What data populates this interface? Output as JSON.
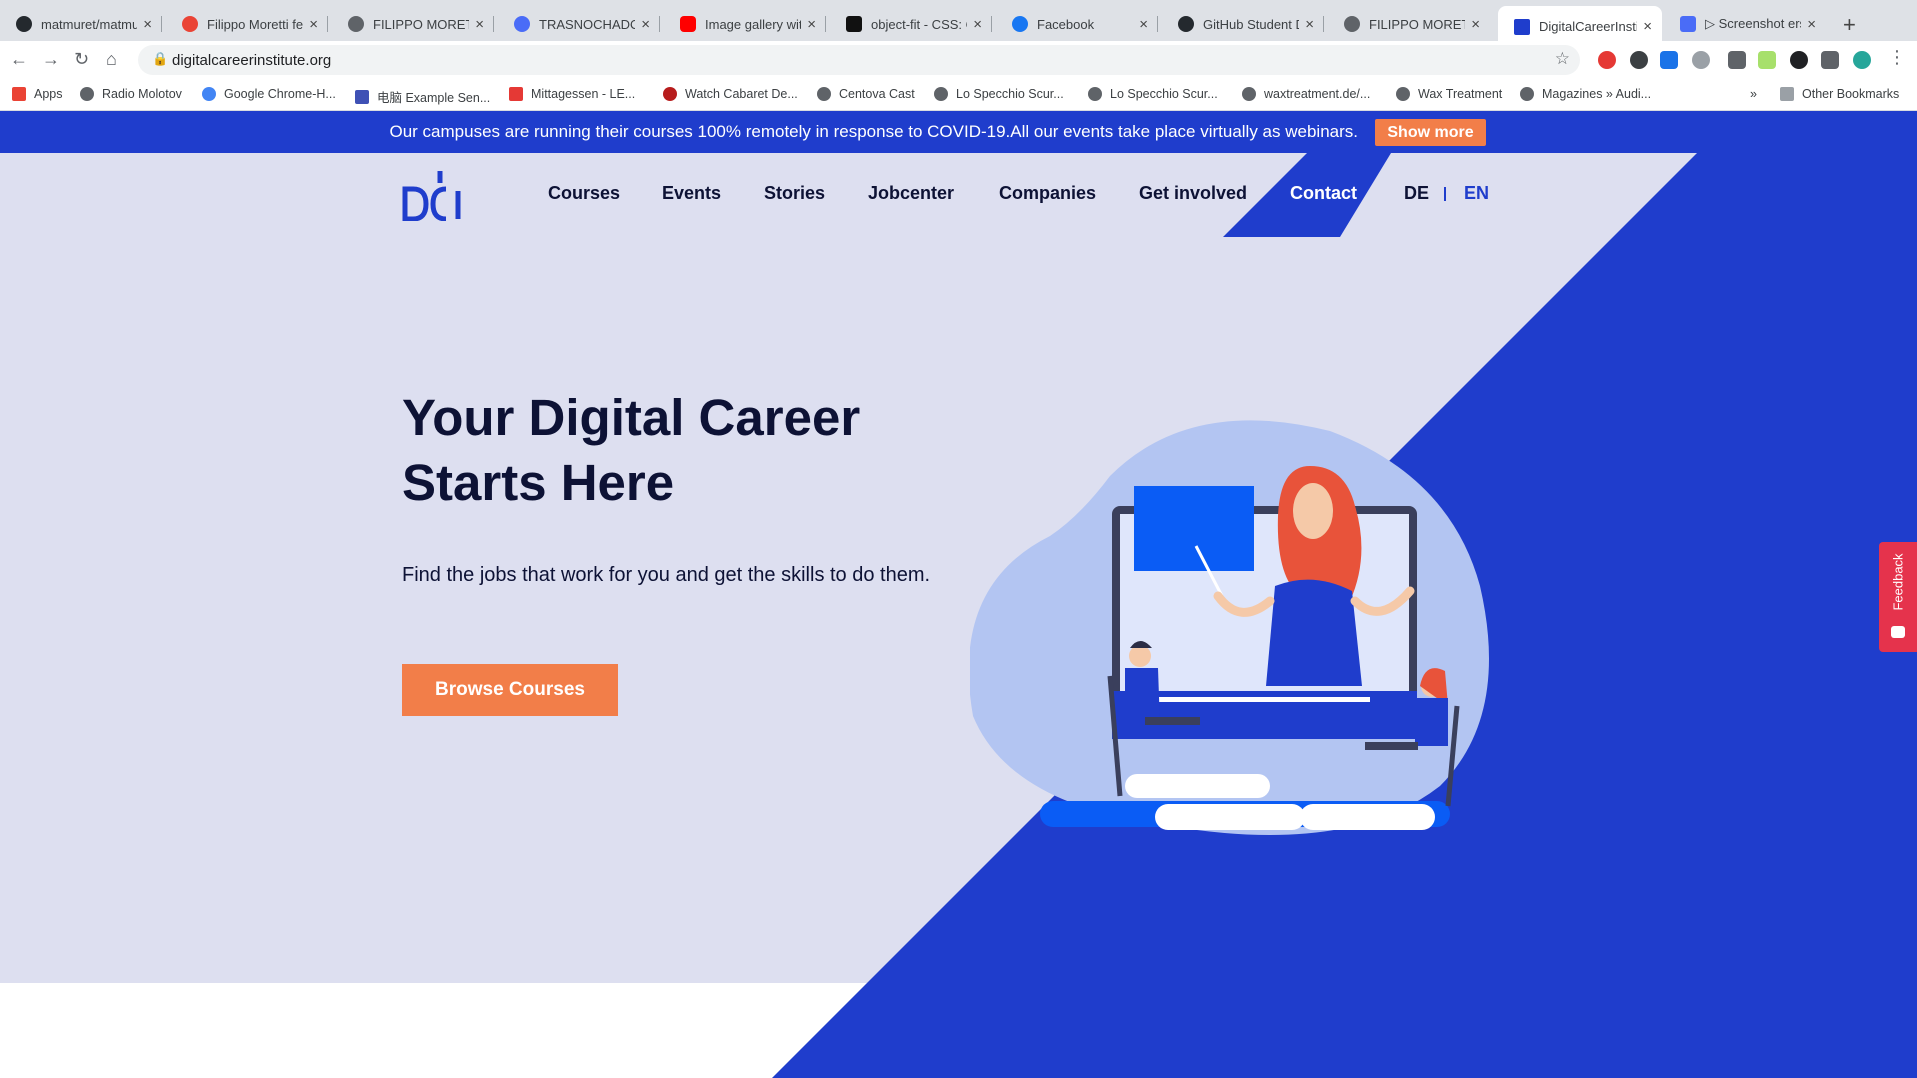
{
  "browser": {
    "tabs": [
      {
        "title": "matmuret/matmuret",
        "icon": "github-icon"
      },
      {
        "title": "Filippo Moretti feedback",
        "icon": "gmail-icon"
      },
      {
        "title": "FILIPPO MORETTI",
        "icon": "globe-icon"
      },
      {
        "title": "TRASNOCHADOS",
        "icon": "c-icon"
      },
      {
        "title": "Image gallery with",
        "icon": "youtube-icon"
      },
      {
        "title": "object-fit - CSS: C",
        "icon": "codepen-icon"
      },
      {
        "title": "Facebook",
        "icon": "facebook-icon"
      },
      {
        "title": "GitHub Student D",
        "icon": "github-icon"
      },
      {
        "title": "FILIPPO MORETTI",
        "icon": "globe-icon"
      },
      {
        "title": "DigitalCareerInstit",
        "icon": "dci-icon"
      },
      {
        "title": "▷ Screenshot erst",
        "icon": "screenshot-icon"
      }
    ],
    "url": "digitalcareerinstitute.org",
    "bookmarks": [
      "Apps",
      "Radio Molotov",
      "Google Chrome-H...",
      "电脑 Example Sen...",
      "Mittagessen - LE...",
      "Watch Cabaret De...",
      "Centova Cast",
      "Lo Specchio Scur...",
      "Lo Specchio Scur...",
      "waxtreatment.de/...",
      "Wax Treatment",
      "Magazines » Audi..."
    ],
    "bookmarks_overflow": "»",
    "other_bookmarks": "Other Bookmarks",
    "new_tab": "+"
  },
  "banner": {
    "text": "Our campuses are running their courses 100% remotely in response to COVID-19.All our events take place virtually as webinars.",
    "button": "Show more"
  },
  "nav": {
    "items": [
      "Courses",
      "Events",
      "Stories",
      "Jobcenter",
      "Companies",
      "Get involved",
      "Contact"
    ],
    "lang_de": "DE",
    "lang_en": "EN"
  },
  "hero": {
    "headline": "Your Digital Career Starts Here",
    "subtext": "Find the jobs that work for you and get the skills to do them.",
    "cta": "Browse Courses"
  },
  "feedback": {
    "label": "Feedback"
  },
  "colors": {
    "brand_blue": "#1f3dcc",
    "accent_orange": "#f27e49",
    "hero_bg": "#dddff0",
    "navy_text": "#0d1235",
    "feedback_red": "#e5334c"
  }
}
